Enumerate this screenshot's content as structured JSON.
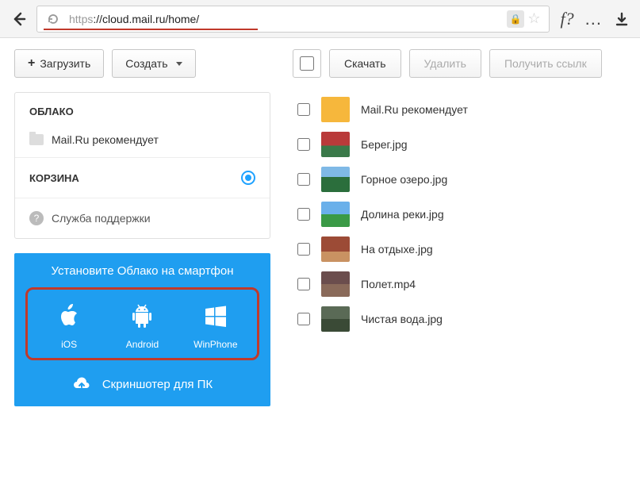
{
  "browser": {
    "url_proto": "https",
    "url_rest": "://cloud.mail.ru/home/",
    "fq": "f?",
    "dots": "..."
  },
  "left": {
    "upload": "Загрузить",
    "create": "Создать",
    "cloud_header": "ОБЛАКО",
    "cloud_item": "Mail.Ru рекомендует",
    "trash_header": "КОРЗИНА",
    "support": "Служба поддержки"
  },
  "promo": {
    "title": "Установите Облако на смартфон",
    "ios": "iOS",
    "android": "Android",
    "winphone": "WinPhone",
    "screenshoter": "Скриншотер для ПК"
  },
  "toolbar": {
    "download": "Скачать",
    "delete": "Удалить",
    "getlink": "Получить ссылк"
  },
  "files": [
    {
      "name": "Mail.Ru рекомендует",
      "thumb": "t-yellow"
    },
    {
      "name": "Берег.jpg",
      "thumb": "t-photo1"
    },
    {
      "name": "Горное озеро.jpg",
      "thumb": "t-photo2"
    },
    {
      "name": "Долина реки.jpg",
      "thumb": "t-photo3"
    },
    {
      "name": "На отдыхе.jpg",
      "thumb": "t-photo4"
    },
    {
      "name": "Полет.mp4",
      "thumb": "t-photo5"
    },
    {
      "name": "Чистая вода.jpg",
      "thumb": "t-photo6"
    }
  ]
}
